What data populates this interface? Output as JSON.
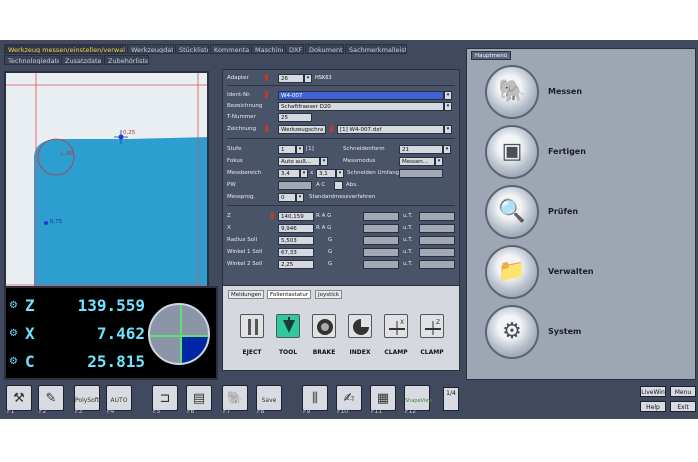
{
  "tabs_row1": [
    "Werkzeug messen/einstellen/verwalten",
    "Werkzeugdaten",
    "Stückliste",
    "Kommentar",
    "Maschine",
    "DXF",
    "Dokumente",
    "Sachmerkmalleiste"
  ],
  "tabs_row2": [
    "Technologiedaten",
    "Zusatzdaten",
    "Zubehörliste"
  ],
  "graphic": {
    "label_center": "L,00",
    "label_top": "0,25",
    "label_bottom": "0,75"
  },
  "form": {
    "adapter": {
      "label": "Adapter",
      "value": "26",
      "code": "HSK63"
    },
    "ident": {
      "label": "Ident-Nr.",
      "value": "W4-007"
    },
    "bezeichnung": {
      "label": "Bezeichnung",
      "value": "Schaftfraeser D20"
    },
    "tnummer": {
      "label": "T-Nummer",
      "value": "25"
    },
    "zeichnung": {
      "label": "Zeichnung",
      "value1": "Werkzeugschra",
      "value2": "[1] W4-007.dxf"
    },
    "stufe": {
      "label": "Stufe",
      "value": "1",
      "extra": "[1]"
    },
    "schneidenform": {
      "label": "Schneidenform",
      "value": "21"
    },
    "fokus": {
      "label": "Fokus",
      "value": "Auto auß..."
    },
    "messmodus": {
      "label": "Messmodus",
      "value": "Messen..."
    },
    "messbereich": {
      "label": "Messbereich",
      "v1": "3,4",
      "x": "x",
      "v2": "3,1"
    },
    "schneiden_umfang": {
      "label": "Schneiden Umfang"
    },
    "pw": {
      "label": "PW",
      "ac": "A C",
      "abs": "Abs."
    },
    "messprog": {
      "label": "Messprog.",
      "value": "0",
      "std": "Standardmessverfahren"
    },
    "z": {
      "label": "Z",
      "value": "140,159",
      "unit": "R A G"
    },
    "x": {
      "label": "X",
      "value": "9,946",
      "unit": "R A G"
    },
    "radius": {
      "label": "Radius Soll",
      "value": "5,503",
      "unit": "G"
    },
    "winkel1": {
      "label": "Winkel 1 Soll",
      "value": "67,33",
      "unit": "G"
    },
    "winkel2": {
      "label": "Winkel 2 Soll",
      "value": "2,25",
      "unit": "G"
    },
    "ot": "o.T.",
    "ut": "u.T."
  },
  "dro": {
    "axes": [
      {
        "axis": "Z",
        "value": "139.559"
      },
      {
        "axis": "X",
        "value": "7.462"
      },
      {
        "axis": "C",
        "value": "25.815"
      }
    ]
  },
  "panel": {
    "tabs": [
      "Meldungen",
      "Folientastatur",
      "Joystick"
    ],
    "buttons": [
      {
        "label": "EJECT",
        "icon": "eject-icon"
      },
      {
        "label": "TOOL",
        "icon": "tool-icon"
      },
      {
        "label": "BRAKE",
        "icon": "brake-icon"
      },
      {
        "label": "INDEX",
        "icon": "index-icon"
      },
      {
        "label": "CLAMP",
        "icon": "clamp-x-icon"
      },
      {
        "label": "CLAMP",
        "icon": "clamp-z-icon"
      }
    ]
  },
  "side": {
    "head": "Hauptmenü",
    "items": [
      {
        "label": "Messen",
        "icon": "elephant-icon"
      },
      {
        "label": "Fertigen",
        "icon": "machine-icon"
      },
      {
        "label": "Prüfen",
        "icon": "magnifier-icon"
      },
      {
        "label": "Verwalten",
        "icon": "folder-icon"
      },
      {
        "label": "System",
        "icon": "gears-icon"
      }
    ]
  },
  "fkeys": [
    {
      "label": "F1"
    },
    {
      "label": "F2"
    },
    {
      "label": "F3",
      "sub": "PolySoft"
    },
    {
      "label": "F4",
      "sub": "AUTO"
    },
    {
      "label": "F5"
    },
    {
      "label": "F6"
    },
    {
      "label": "F7"
    },
    {
      "label": "F8",
      "sub": "Save"
    },
    {
      "label": "F9"
    },
    {
      "label": "F10"
    },
    {
      "label": "F11"
    },
    {
      "label": "F12",
      "sub": "ShapeView"
    }
  ],
  "page_indicator": "1/4",
  "right_buttons": {
    "livewin": "LiveWin",
    "menu": "Menu",
    "help": "Help",
    "exit": "Exit"
  }
}
